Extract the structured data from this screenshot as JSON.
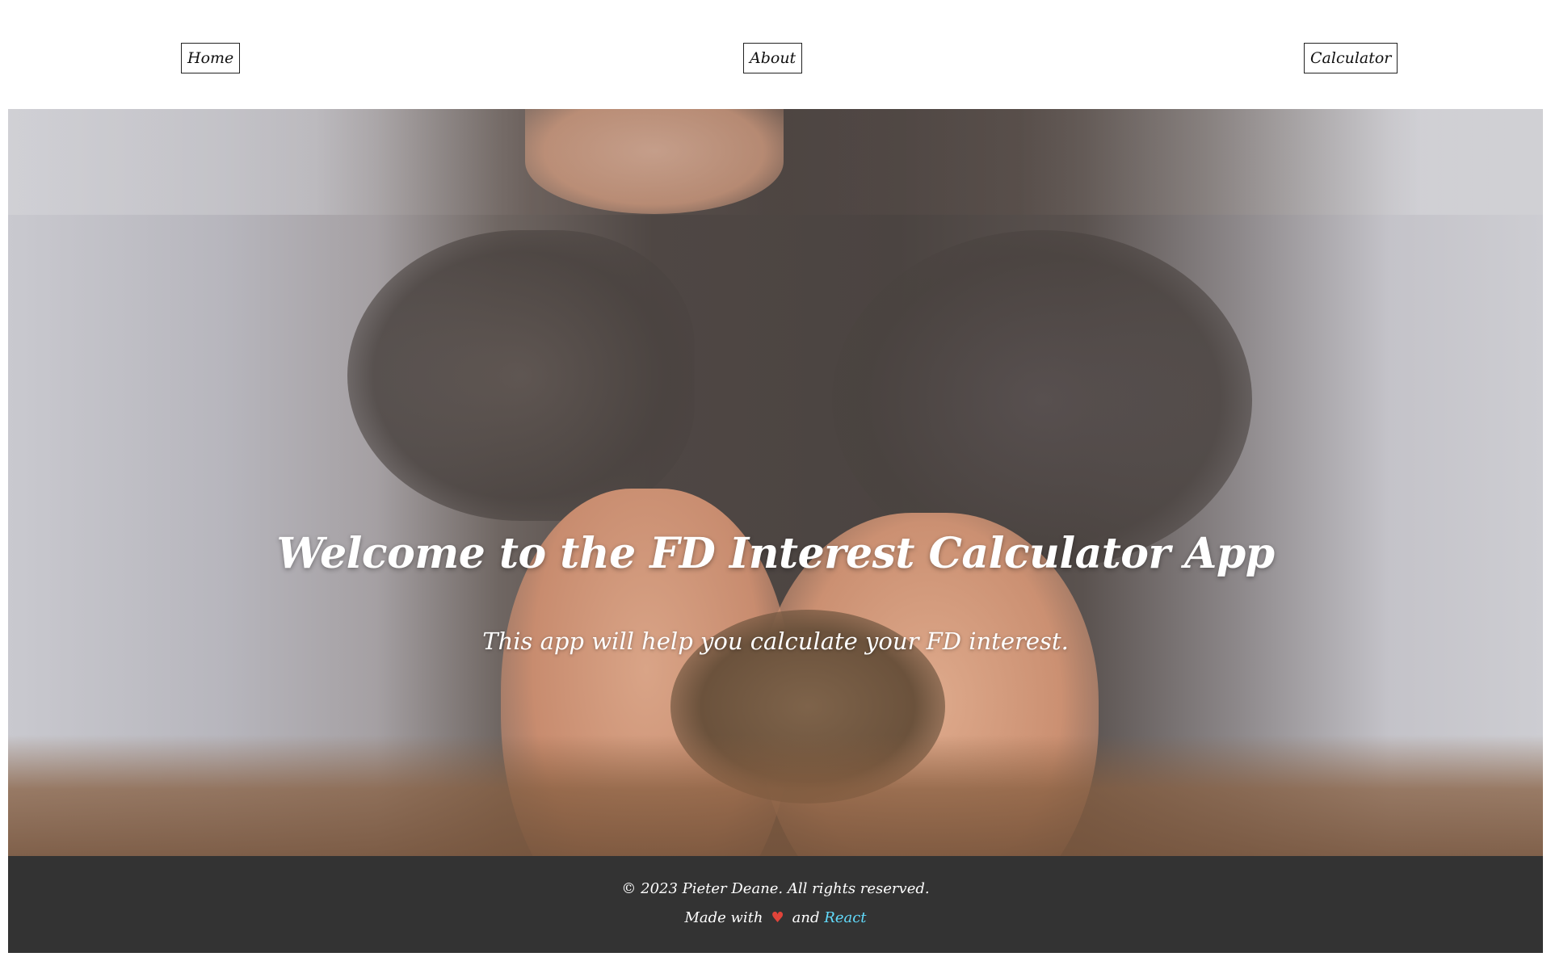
{
  "nav": {
    "home_label": "Home",
    "about_label": "About",
    "calculator_label": "Calculator"
  },
  "hero": {
    "title": "Welcome to the FD Interest Calculator App",
    "subtitle": "This app will help you calculate your FD interest."
  },
  "footer": {
    "copyright": "© 2023 Pieter Deane. All rights reserved.",
    "made_with_prefix": "Made with",
    "heart_icon": "♥",
    "and_text": "and",
    "react_link": "React"
  },
  "colors": {
    "footer_bg": "#333333",
    "heart": "#e0443a",
    "react_link": "#61dafb"
  }
}
